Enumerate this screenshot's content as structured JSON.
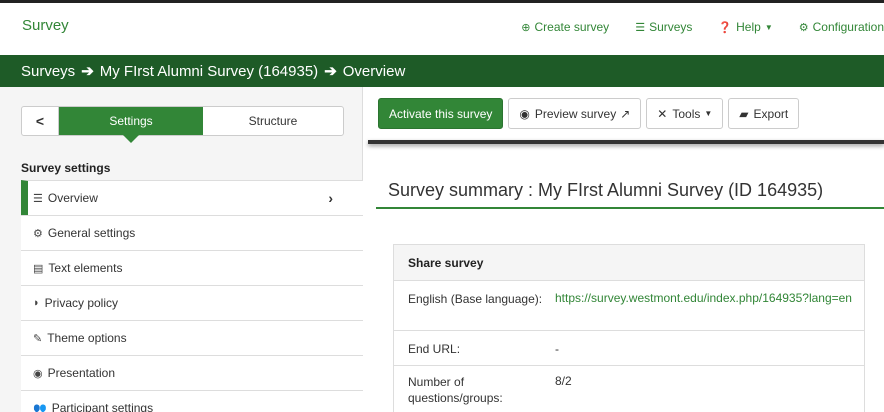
{
  "topbar": {
    "brand": "Survey",
    "nav": [
      {
        "icon": "plus-circle-icon",
        "glyph": "⊕",
        "label": "Create survey"
      },
      {
        "icon": "list-icon",
        "glyph": "☰",
        "label": "Surveys"
      },
      {
        "icon": "question-circle-icon",
        "glyph": "❓",
        "label": "Help"
      },
      {
        "icon": "gears-icon",
        "glyph": "⚙",
        "label": "Configuration"
      }
    ]
  },
  "breadcrumb": {
    "items": [
      "Surveys",
      "My FIrst Alumni Survey (164935)",
      "Overview"
    ]
  },
  "sidebar": {
    "back_label": "<",
    "tab_settings": "Settings",
    "tab_structure": "Structure",
    "heading": "Survey settings",
    "items": [
      {
        "icon": "list-icon",
        "glyph": "☰",
        "label": "Overview"
      },
      {
        "icon": "gears-icon",
        "glyph": "⚙",
        "label": "General settings"
      },
      {
        "icon": "file-text-icon",
        "glyph": "▤",
        "label": "Text elements"
      },
      {
        "icon": "shield-icon",
        "glyph": "◗",
        "label": "Privacy policy"
      },
      {
        "icon": "paint-brush-icon",
        "glyph": "✎",
        "label": "Theme options"
      },
      {
        "icon": "eye-slash-icon",
        "glyph": "◉",
        "label": "Presentation"
      },
      {
        "icon": "users-icon",
        "glyph": "👥",
        "label": "Participant settings"
      }
    ]
  },
  "toolbar": {
    "activate": "Activate this survey",
    "preview": "Preview survey",
    "tools": "Tools",
    "export": "Export"
  },
  "summary": {
    "title": "Survey summary : My FIrst Alumni Survey (ID 164935)"
  },
  "share_panel": {
    "heading": "Share survey",
    "rows": [
      {
        "key": "English (Base language):",
        "value": "https://survey.westmont.edu/index.php/164935?lang=en"
      },
      {
        "key": "End URL:",
        "value": "-"
      },
      {
        "key": "Number of questions/groups:",
        "value": "8/2"
      }
    ]
  },
  "colors": {
    "accent": "#328637",
    "breadcrumb_bg": "#1e5b27"
  }
}
